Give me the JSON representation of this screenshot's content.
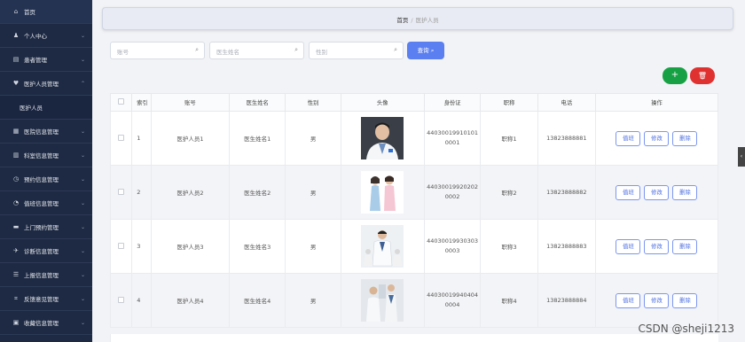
{
  "sidebar": {
    "items": [
      {
        "icon": "home-icon",
        "glyph": "⌂",
        "label": "首页"
      },
      {
        "icon": "user-icon",
        "glyph": "♟",
        "label": "个人中心"
      },
      {
        "icon": "patient-icon",
        "glyph": "▤",
        "label": "患者管理"
      },
      {
        "icon": "staff-icon",
        "glyph": "♥",
        "label": "医护人员管理"
      },
      {
        "label": "医护人员"
      },
      {
        "icon": "hospital-icon",
        "glyph": "▦",
        "label": "医院信息管理"
      },
      {
        "icon": "department-icon",
        "glyph": "▥",
        "label": "科室信息管理"
      },
      {
        "icon": "clock-icon",
        "glyph": "◷",
        "label": "预约信息管理"
      },
      {
        "icon": "duty-icon",
        "glyph": "◔",
        "label": "值班信息管理"
      },
      {
        "icon": "visit-icon",
        "glyph": "▬",
        "label": "上门预约管理"
      },
      {
        "icon": "plane-icon",
        "glyph": "✈",
        "label": "诊断信息管理"
      },
      {
        "icon": "report-icon",
        "glyph": "☰",
        "label": "上报信息管理"
      },
      {
        "icon": "feedback-icon",
        "glyph": "⌗",
        "label": "反馈意见管理"
      },
      {
        "icon": "collect-icon",
        "glyph": "▣",
        "label": "收藏信息管理"
      }
    ]
  },
  "breadcrumb": {
    "home": "首页",
    "sep": "/",
    "current": "医护人员"
  },
  "search": {
    "account_placeholder": "账号",
    "name_placeholder": "医生姓名",
    "gender_placeholder": "性别",
    "button_label": "查询"
  },
  "toolbar": {
    "add_glyph": "+",
    "delete_glyph": "🗑"
  },
  "table": {
    "columns": [
      "",
      "索引",
      "账号",
      "医生姓名",
      "性别",
      "头像",
      "身份证",
      "职称",
      "电话",
      "操作"
    ],
    "rows": [
      {
        "index": "1",
        "account": "医护人员1",
        "name": "医生姓名1",
        "gender": "男",
        "id_line1": "44030019910101",
        "id_line2": "0001",
        "title": "职称1",
        "phone": "13823888881"
      },
      {
        "index": "2",
        "account": "医护人员2",
        "name": "医生姓名2",
        "gender": "男",
        "id_line1": "44030019920202",
        "id_line2": "0002",
        "title": "职称2",
        "phone": "13823888882"
      },
      {
        "index": "3",
        "account": "医护人员3",
        "name": "医生姓名3",
        "gender": "男",
        "id_line1": "44030019930303",
        "id_line2": "0003",
        "title": "职称3",
        "phone": "13823888883"
      },
      {
        "index": "4",
        "account": "医护人员4",
        "name": "医生姓名4",
        "gender": "男",
        "id_line1": "44030019940404",
        "id_line2": "0004",
        "title": "职称4",
        "phone": "13823888884"
      }
    ],
    "actions": {
      "duty": "值班",
      "edit": "修改",
      "delete": "删除"
    }
  },
  "watermark": "CSDN @sheji1213"
}
